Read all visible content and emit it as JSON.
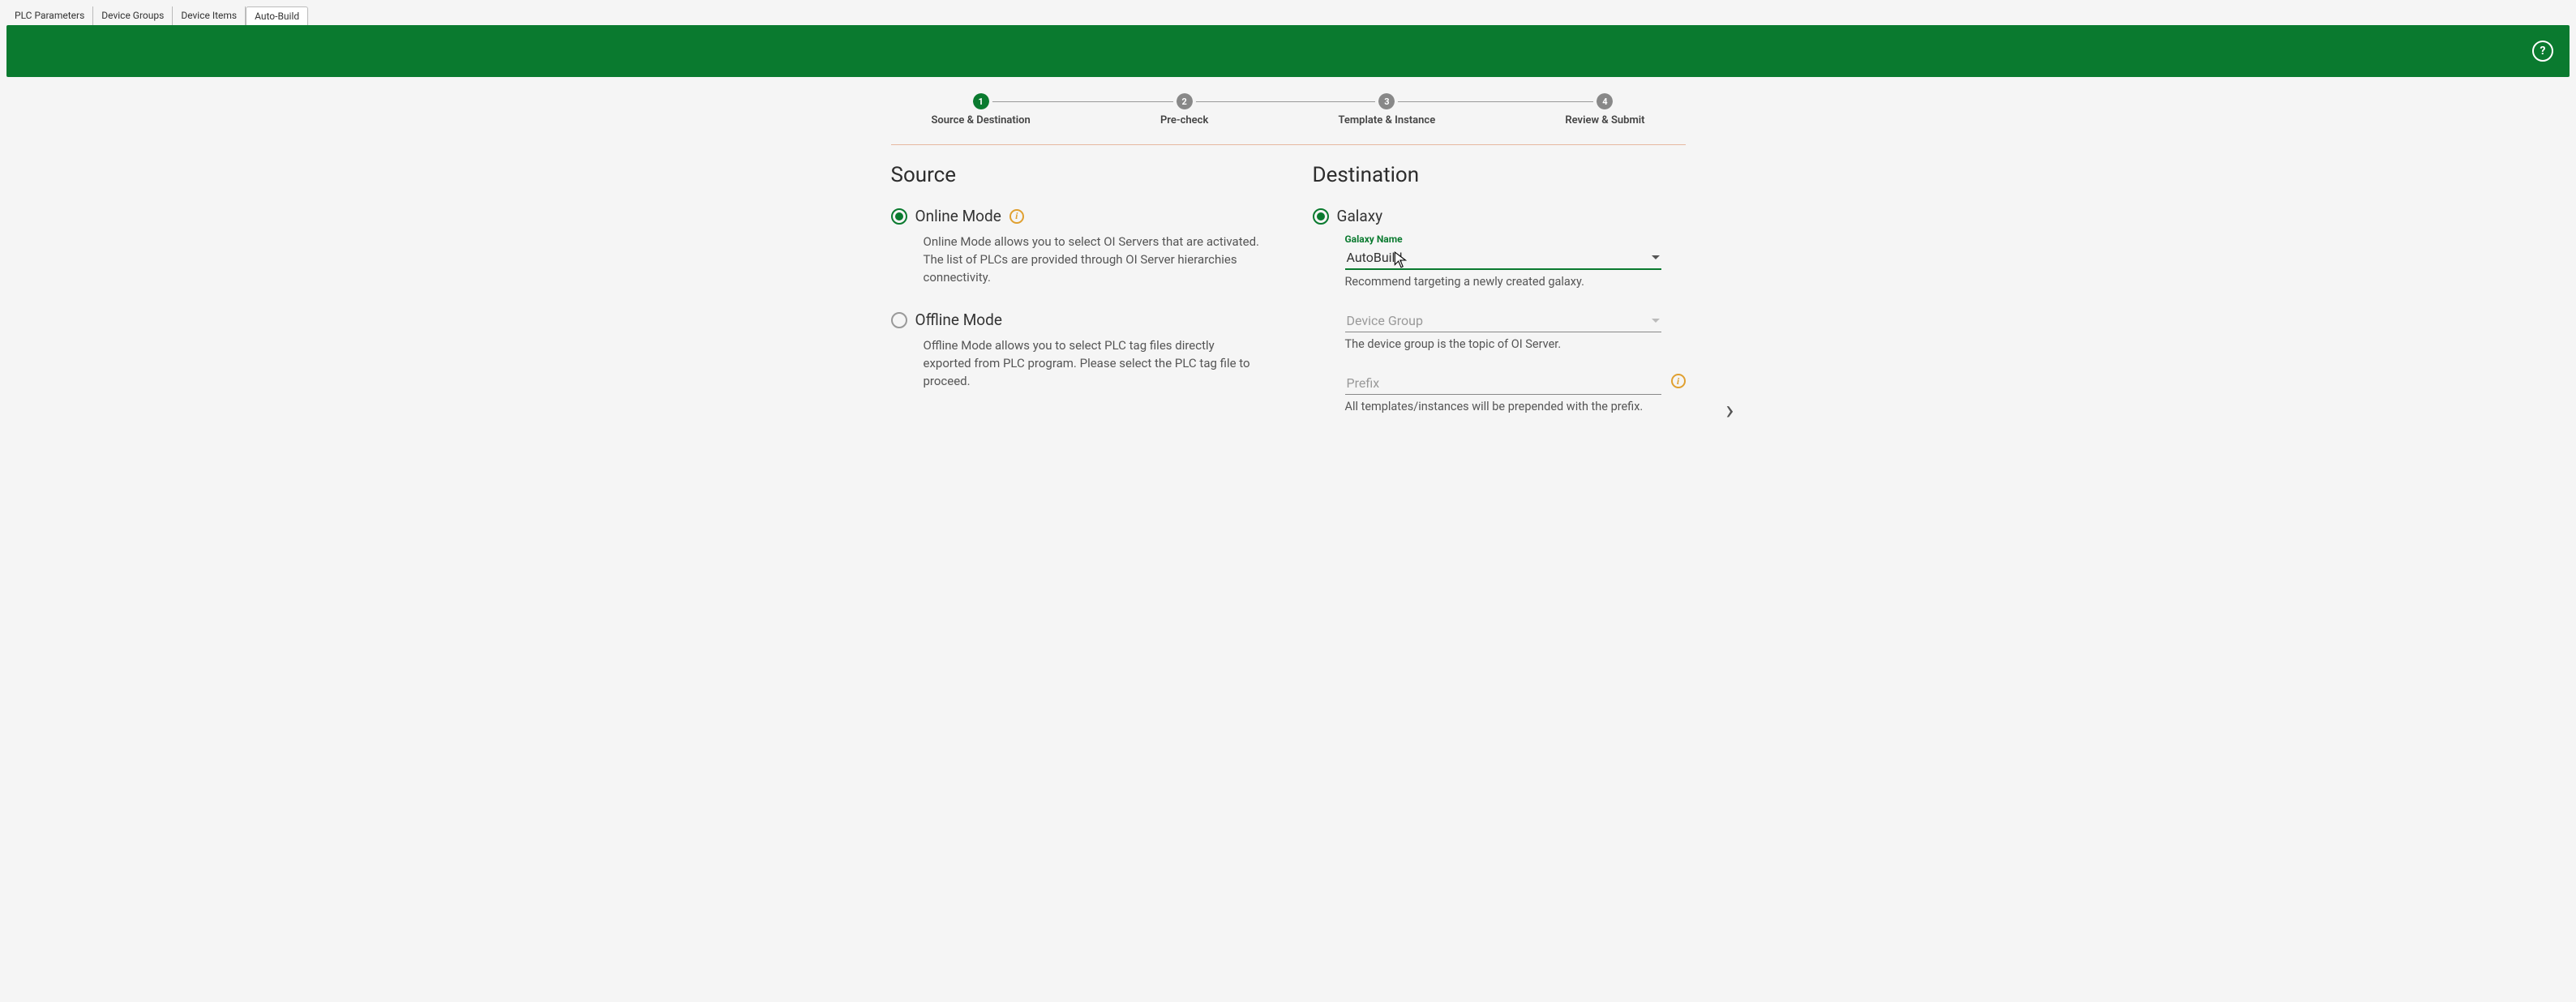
{
  "tabs": {
    "items": [
      {
        "label": "PLC Parameters",
        "active": false
      },
      {
        "label": "Device Groups",
        "active": false
      },
      {
        "label": "Device Items",
        "active": false
      },
      {
        "label": "Auto-Build",
        "active": true
      }
    ]
  },
  "help_tooltip": "?",
  "stepper": {
    "steps": [
      {
        "num": "1",
        "label": "Source & Destination",
        "active": true
      },
      {
        "num": "2",
        "label": "Pre-check",
        "active": false
      },
      {
        "num": "3",
        "label": "Template & Instance",
        "active": false
      },
      {
        "num": "4",
        "label": "Review & Submit",
        "active": false
      }
    ]
  },
  "source": {
    "title": "Source",
    "online": {
      "label": "Online Mode",
      "selected": true,
      "desc": "Online Mode allows you to select OI Servers that are activated. The list of PLCs are provided through OI Server hierarchies connectivity."
    },
    "offline": {
      "label": "Offline Mode",
      "selected": false,
      "desc": "Offline Mode allows you to select PLC tag files directly exported from PLC program. Please select the PLC tag file to proceed."
    }
  },
  "destination": {
    "title": "Destination",
    "galaxy": {
      "label": "Galaxy",
      "selected": true
    },
    "galaxy_name": {
      "label": "Galaxy Name",
      "value": "AutoBuild",
      "hint": "Recommend targeting a newly created galaxy."
    },
    "device_group": {
      "placeholder": "Device Group",
      "hint": "The device group is the topic of OI Server."
    },
    "prefix": {
      "placeholder": "Prefix",
      "hint": "All templates/instances will be prepended with the prefix."
    }
  },
  "info_glyph": "i",
  "next_glyph": "›"
}
